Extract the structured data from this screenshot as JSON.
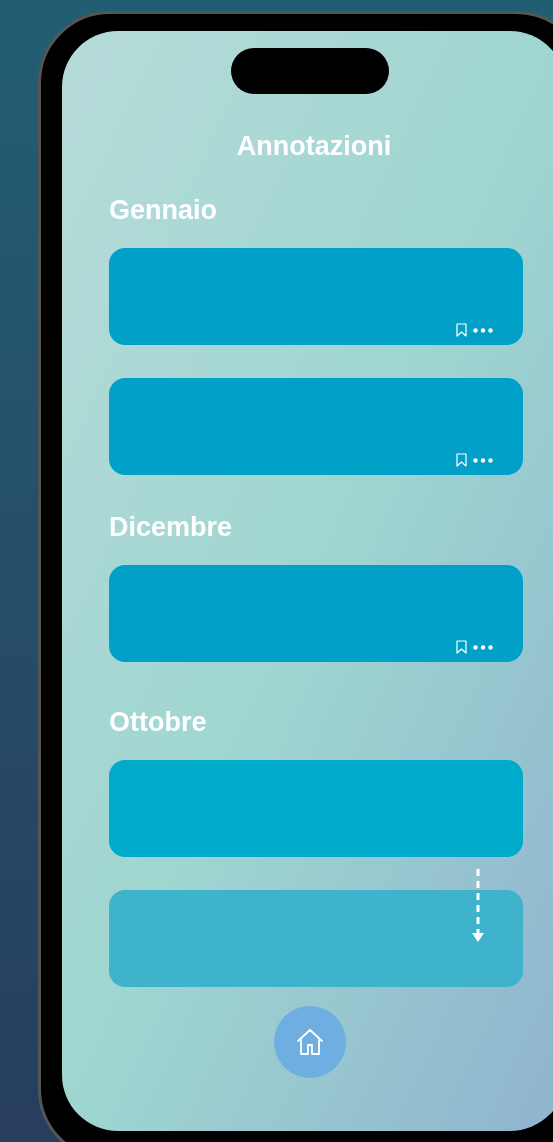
{
  "screen": {
    "title": "Annotazioni"
  },
  "sections": [
    {
      "heading": "Gennaio",
      "cards": [
        {
          "kind": "actions"
        },
        {
          "kind": "actions"
        }
      ]
    },
    {
      "heading": "Dicembre",
      "cards": [
        {
          "kind": "actions"
        }
      ]
    },
    {
      "heading": "Ottobre",
      "cards": [
        {
          "kind": "plain"
        },
        {
          "kind": "faded"
        }
      ]
    }
  ]
}
